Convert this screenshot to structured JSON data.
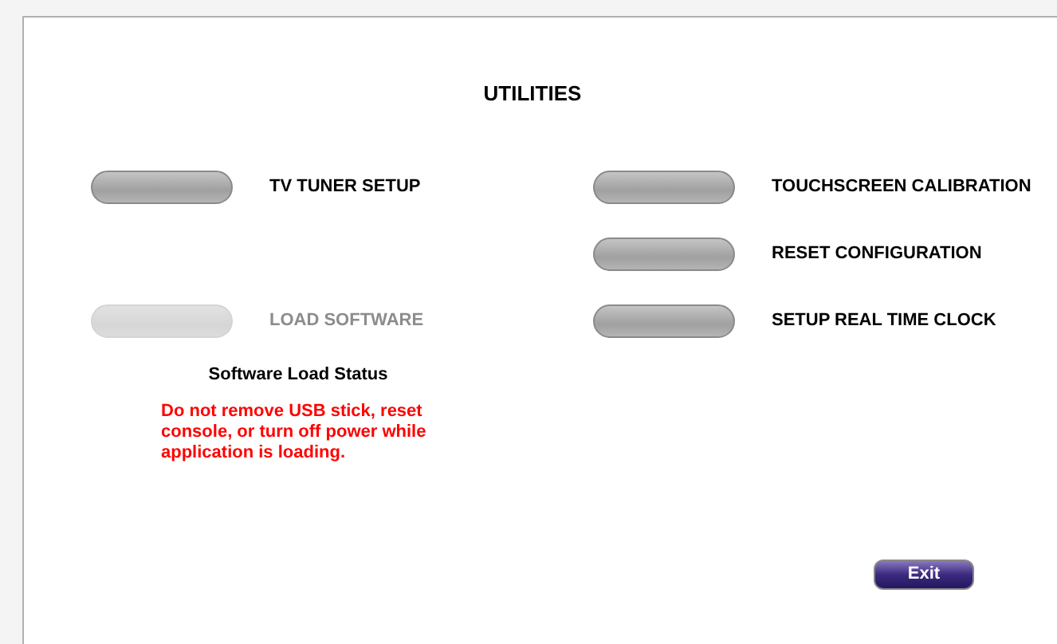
{
  "title": "UTILITIES",
  "rows": [
    {
      "left": {
        "label": "TV TUNER SETUP",
        "disabled": false
      },
      "right": {
        "label": "TOUCHSCREEN CALIBRATION",
        "disabled": false
      }
    },
    {
      "right": {
        "label": "RESET CONFIGURATION",
        "disabled": false
      }
    },
    {
      "left": {
        "label": "LOAD SOFTWARE",
        "disabled": true
      },
      "right": {
        "label": "SETUP REAL TIME CLOCK",
        "disabled": false
      }
    }
  ],
  "status": {
    "heading": "Software Load Status",
    "warning": "Do not remove USB stick, reset console, or turn off power while application is loading."
  },
  "exit_button": "Exit"
}
